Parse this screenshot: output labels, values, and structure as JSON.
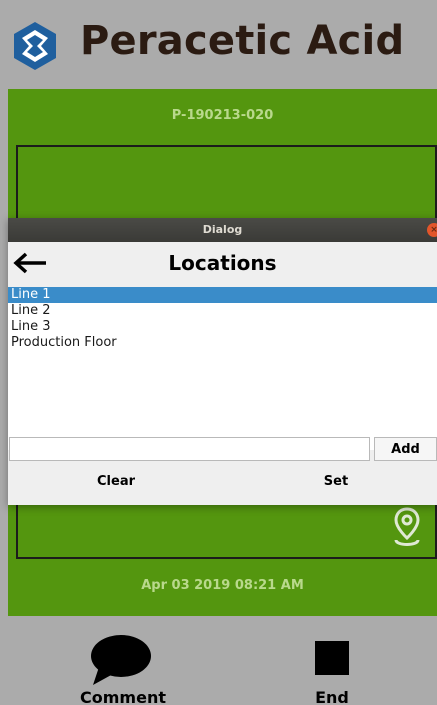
{
  "header": {
    "title": "Peracetic Acid",
    "logo_icon": "hexagon-logo-icon",
    "title_color": "#2b1b12"
  },
  "main": {
    "record_id": "P-190213-020",
    "timestamp": "Apr 03 2019 08:21 AM",
    "location_icon": "map-pin-icon",
    "background_color": "#54960f"
  },
  "dialog": {
    "window_title": "Dialog",
    "heading": "Locations",
    "back_icon": "back-arrow-icon",
    "close_icon": "close-icon",
    "close_glyph": "×",
    "locations": [
      {
        "label": "Line 1",
        "selected": true
      },
      {
        "label": "Line 2",
        "selected": false
      },
      {
        "label": "Line 3",
        "selected": false
      },
      {
        "label": "Production Floor",
        "selected": false
      }
    ],
    "new_location_value": "",
    "add_label": "Add",
    "clear_label": "Clear",
    "set_label": "Set",
    "selection_color": "#3a8cc9"
  },
  "bottom_bar": {
    "comment_label": "Comment",
    "comment_icon": "speech-bubble-icon",
    "end_label": "End",
    "end_icon": "stop-square-icon"
  }
}
